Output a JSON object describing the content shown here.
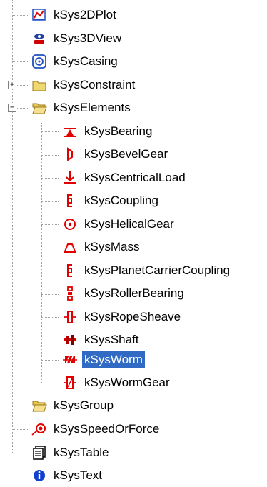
{
  "tree": {
    "items": [
      {
        "label": "kSys2DPlot",
        "icon": "chart-2d-plot-icon"
      },
      {
        "label": "kSys3DView",
        "icon": "3d-view-icon"
      },
      {
        "label": "kSysCasing",
        "icon": "casing-icon"
      },
      {
        "label": "kSysConstraint",
        "icon": "folder-closed-icon",
        "expander": "+"
      },
      {
        "label": "kSysElements",
        "icon": "folder-open-icon",
        "expander": "−",
        "children": [
          {
            "label": "kSysBearing",
            "icon": "bearing-icon"
          },
          {
            "label": "kSysBevelGear",
            "icon": "bevel-gear-icon"
          },
          {
            "label": "kSysCentricalLoad",
            "icon": "centrical-load-icon"
          },
          {
            "label": "kSysCoupling",
            "icon": "coupling-icon"
          },
          {
            "label": "kSysHelicalGear",
            "icon": "helical-gear-icon"
          },
          {
            "label": "kSysMass",
            "icon": "mass-icon"
          },
          {
            "label": "kSysPlanetCarrierCoupling",
            "icon": "planet-carrier-coupling-icon"
          },
          {
            "label": "kSysRollerBearing",
            "icon": "roller-bearing-icon"
          },
          {
            "label": "kSysRopeSheave",
            "icon": "rope-sheave-icon"
          },
          {
            "label": "kSysShaft",
            "icon": "shaft-icon"
          },
          {
            "label": "kSysWorm",
            "icon": "worm-icon",
            "selected": true
          },
          {
            "label": "kSysWormGear",
            "icon": "worm-gear-icon"
          }
        ]
      },
      {
        "label": "kSysGroup",
        "icon": "folder-open-icon"
      },
      {
        "label": "kSysSpeedOrForce",
        "icon": "speed-or-force-icon"
      },
      {
        "label": "kSysTable",
        "icon": "table-icon"
      },
      {
        "label": "kSysText",
        "icon": "info-icon"
      }
    ]
  },
  "colors": {
    "selection": "#316ac5",
    "element_icon": "#e00000",
    "folder": "#f0d870",
    "guide_line": "#a0a0a0"
  }
}
